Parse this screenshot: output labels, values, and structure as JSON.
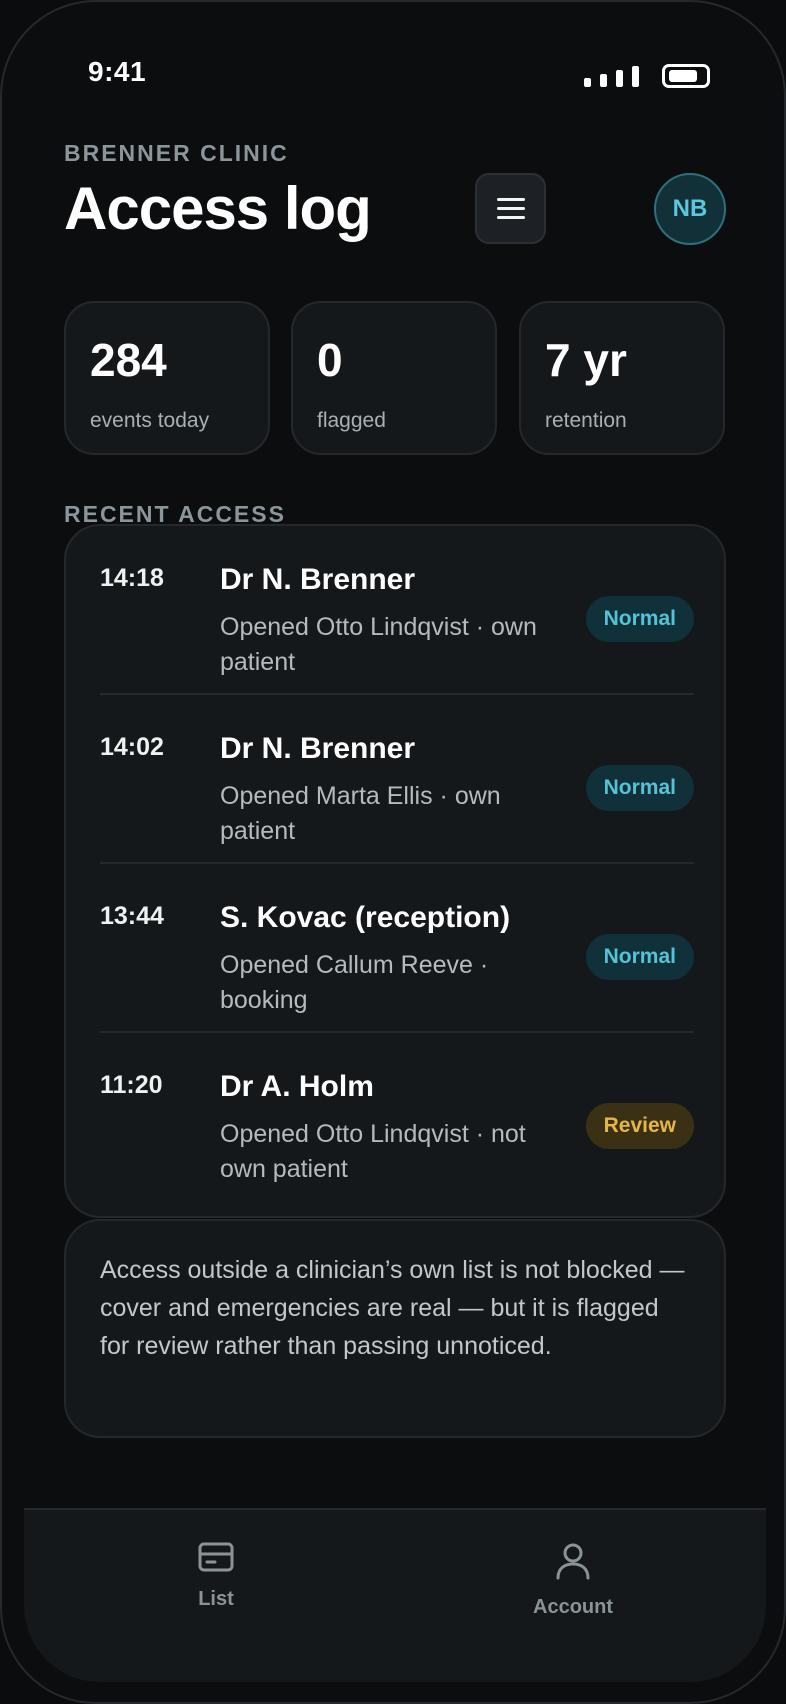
{
  "status_bar": {
    "time": "9:41"
  },
  "header": {
    "clinic": "BRENNER CLINIC",
    "title": "Access log",
    "avatar_initials": "NB"
  },
  "stats": [
    {
      "value": "284",
      "label": "events today"
    },
    {
      "value": "0",
      "label": "flagged"
    },
    {
      "value": "7 yr",
      "label": "retention"
    }
  ],
  "section_label": "RECENT ACCESS",
  "entries": [
    {
      "time": "14:18",
      "name": "Dr N. Brenner",
      "description": "Opened Otto Lindqvist · own patient",
      "status": "Normal"
    },
    {
      "time": "14:02",
      "name": "Dr N. Brenner",
      "description": "Opened Marta Ellis · own patient",
      "status": "Normal"
    },
    {
      "time": "13:44",
      "name": "S. Kovac (reception)",
      "description": "Opened Callum Reeve · booking",
      "status": "Normal"
    },
    {
      "time": "11:20",
      "name": "Dr A. Holm",
      "description": "Opened Otto Lindqvist · not own patient",
      "status": "Review"
    }
  ],
  "note": "Access outside a clinician’s own list is not blocked — cover and emergencies are real — but it is flagged for review rather than passing unnoticed.",
  "tabs": [
    {
      "label": "List",
      "icon": "card-icon"
    },
    {
      "label": "Account",
      "icon": "person-icon"
    }
  ],
  "colors": {
    "accent": "#56c2d6",
    "normal_badge_bg": "#10313a",
    "review_badge_text": "#e5b547",
    "review_badge_bg": "#3a3115",
    "background": "#0b0d0f",
    "card": "#15181b"
  }
}
